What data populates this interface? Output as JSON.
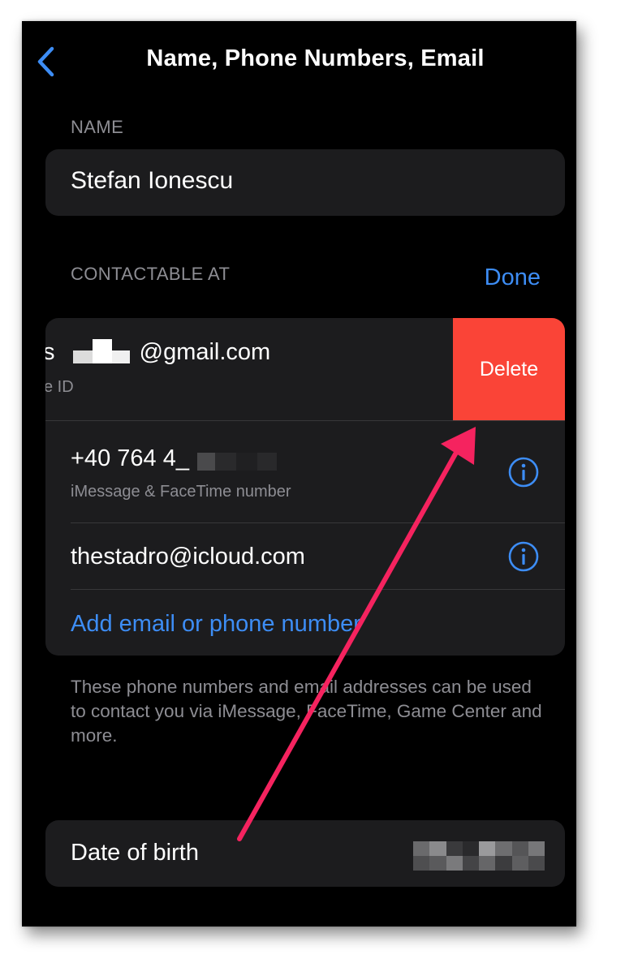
{
  "header": {
    "title": "Name, Phone Numbers, Email",
    "back_label": "back"
  },
  "name_section": {
    "header": "NAME",
    "value": "Stefan Ionescu"
  },
  "contact_section": {
    "header": "CONTACTABLE AT",
    "done_label": "Done",
    "rows": [
      {
        "value_prefix": "s",
        "value_suffix": "@gmail.com",
        "subtitle": "e ID",
        "delete_label": "Delete"
      },
      {
        "value": "+40 764 4_",
        "subtitle": "iMessage & FaceTime number"
      },
      {
        "value": "thestadro@icloud.com"
      }
    ],
    "add_label": "Add email or phone number",
    "footnote": "These phone numbers and email addresses can be used to contact you via iMessage, FaceTime, Game Center and more."
  },
  "dob": {
    "label": "Date of birth"
  },
  "colors": {
    "accent": "#3d8df5",
    "delete": "#fa4437",
    "annotation_arrow": "#f5235f",
    "background": "#000000",
    "card": "#1c1c1e"
  },
  "icons": {
    "back": "chevron-left-icon",
    "info": "info-circle-icon"
  }
}
